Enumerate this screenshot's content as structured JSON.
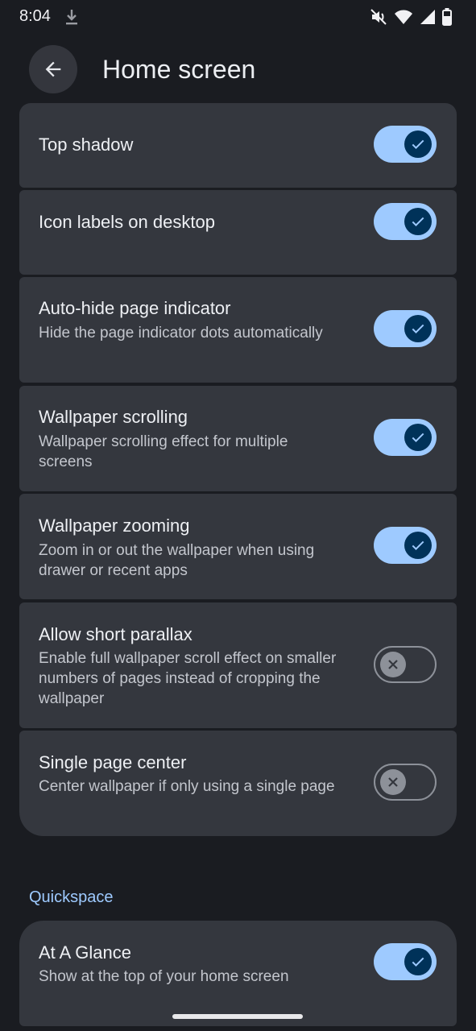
{
  "status_bar": {
    "time": "8:04"
  },
  "header": {
    "title": "Home screen"
  },
  "settings": [
    {
      "title": "Top shadow",
      "subtitle": "",
      "enabled": true
    },
    {
      "title": "Icon labels on desktop",
      "subtitle": "",
      "enabled": true
    },
    {
      "title": "Auto-hide page indicator",
      "subtitle": "Hide the page indicator dots automatically",
      "enabled": true
    },
    {
      "title": "Wallpaper scrolling",
      "subtitle": "Wallpaper scrolling effect for multiple screens",
      "enabled": true
    },
    {
      "title": "Wallpaper zooming",
      "subtitle": "Zoom in or out the wallpaper when using drawer or recent apps",
      "enabled": true
    },
    {
      "title": "Allow short parallax",
      "subtitle": "Enable full wallpaper scroll effect on smaller numbers of pages instead of cropping the wallpaper",
      "enabled": false
    },
    {
      "title": "Single page center",
      "subtitle": "Center wallpaper if only using a single page",
      "enabled": false
    }
  ],
  "quickspace": {
    "header": "Quickspace",
    "items": [
      {
        "title": "At A Glance",
        "subtitle": "Show at the top of your home screen",
        "enabled": true
      }
    ]
  },
  "colors": {
    "accent": "#9ecaff",
    "card": "#34373e",
    "background": "#1a1c21"
  }
}
